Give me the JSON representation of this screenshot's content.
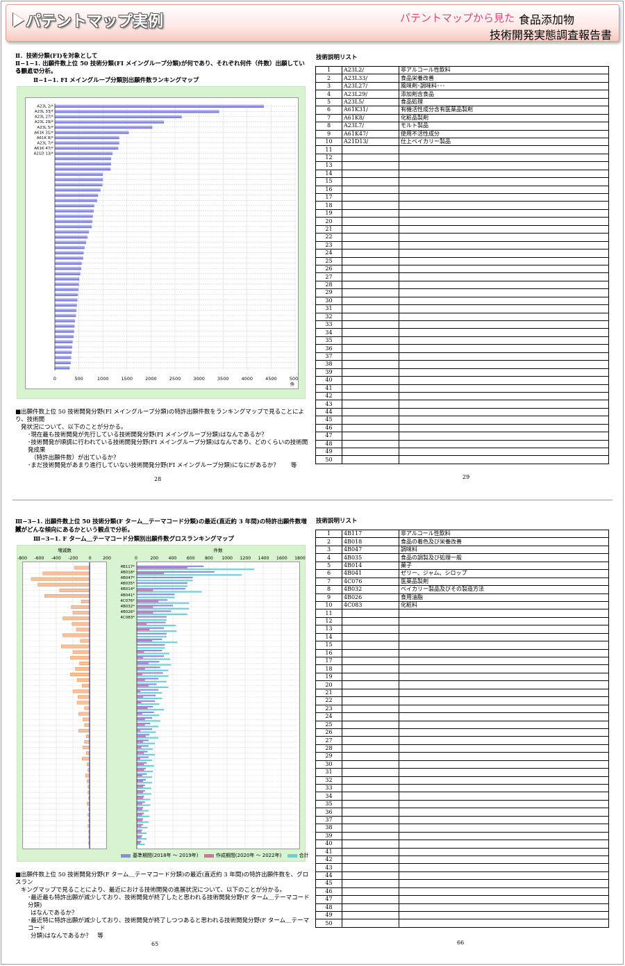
{
  "header": {
    "title": "パテントマップ実例",
    "subtitle_pink": "パテントマップから見た",
    "subtitle_black": "食品添加物",
    "subtitle_line2": "技術開発実態調査報告書"
  },
  "top_left": {
    "section": "Ⅱ．技術分類(FI)を対象として",
    "heading": "Ⅱ−1−1. 出願件数上位 50 技術分類(FI メイングループ分類)が何であり、それぞれ何件（件数）出願しているかとい",
    "heading2": "う観点で分析。",
    "chart_title": "Ⅱ−1−1. FI メイングループ分類別出願件数ランキングマップ",
    "unit": "件",
    "bullets": [
      "■出願件数上位 50 技術開発分野(FI メイングループ分類)の特許出願件数をランキングマップで見ることにより、技術開",
      "発状況について、以下のことが分かる。",
      "･現在最も技術開発が先行している技術開発分野(FI メイングループ分類)はなんであるか？",
      "･技術開発が順調に行われている技術開発分野(FI メイングループ分類)はなんであり、どのくらいの技術開発成果",
      "（特許出願件数）が出ているか？",
      "･まだ技術開発があまり進行していない技術開発分野(FI メイングループ分類)になにがあるか？　　等"
    ],
    "page": "28"
  },
  "top_right": {
    "title": "技術説明リスト",
    "rows": [
      [
        "1",
        "A23L2/",
        "非アルコール性飲料"
      ],
      [
        "2",
        "A23L33/",
        "食品栄養改善"
      ],
      [
        "3",
        "A23L27/",
        "風味剤･調味料･･･"
      ],
      [
        "4",
        "A23L29/",
        "添加剤含食品"
      ],
      [
        "5",
        "A23L5/",
        "食品処理"
      ],
      [
        "6",
        "A61K31/",
        "有機活性成分含有医薬品製剤"
      ],
      [
        "7",
        "A61K8/",
        "化粧品製剤"
      ],
      [
        "8",
        "A23L7/",
        "モルト製品"
      ],
      [
        "9",
        "A61K47/",
        "使用不活性成分"
      ],
      [
        "10",
        "A21D13/",
        "仕上ベイカリー製品"
      ]
    ],
    "page": "29"
  },
  "bottom_left": {
    "heading": "Ⅲ−3−1. 出願件数上位 50 技術分類(F ターム＿テーマコード分類)の最近(直近約 3 年間)の特許出願件数増減",
    "heading2": "数がどんな傾向にあるかという観点で分析。",
    "chart_title": "Ⅲ−3−1. F ターム＿テーマコード分類別出願件数グロスランキングマップ",
    "left_axis_title": "増減数",
    "right_axis_title": "件数",
    "legend": [
      "基準期間(2018年 ～ 2019年)",
      "作成期間(2020年 ～ 2022年)",
      "合計"
    ],
    "bullets": [
      "■出願件数上位 50 技術開発分野(F ターム＿テーマコード分類)の最近(直近約 3 年間)の特許出願件数を、グロスラン",
      "キングマップで見ることにより、最近における技術開発の進展状況について、以下のことが分かる。",
      "･最近最も特許出願が減少しており、技術開発が終了したと思われる技術開発分野(F ターム＿テーマコード分類)",
      "はなんであるか？",
      "･最近特に特許出願が減少しており、技術開発が終了しつつあると思われる技術開発分野(F ターム＿テーマコード",
      "分類)はなんであるか？　等"
    ],
    "page": "65"
  },
  "bottom_right": {
    "title": "技術説明リスト",
    "rows": [
      [
        "1",
        "4B117",
        "非アルコール性飲料"
      ],
      [
        "2",
        "4B018",
        "食品の着色及び栄養改善"
      ],
      [
        "3",
        "4B047",
        "調味料"
      ],
      [
        "4",
        "4B035",
        "食品の調製及び処理一般"
      ],
      [
        "5",
        "4B014",
        "菓子"
      ],
      [
        "6",
        "4B041",
        "ゼリー、ジャム、シロップ"
      ],
      [
        "7",
        "4C076",
        "医薬品製剤"
      ],
      [
        "8",
        "4B032",
        "ベイカリー製品及びその製造方法"
      ],
      [
        "9",
        "4B026",
        "食用油脂"
      ],
      [
        "10",
        "4C083",
        "化粧料"
      ]
    ],
    "page": "66"
  },
  "chart_data": [
    {
      "type": "bar",
      "orientation": "horizontal",
      "title": "Ⅱ−1−1. FI メイングループ分類別出願件数ランキングマップ",
      "xlabel": "件",
      "xlim": [
        0,
        5000
      ],
      "xticks": [
        0,
        500,
        1000,
        1500,
        2000,
        2500,
        3000,
        3500,
        4000,
        4500,
        5000
      ],
      "categories": [
        "A23L 2/*",
        "A23L 33/*",
        "A23L 27/*",
        "A23L 29/*",
        "A23L 5/*",
        "A61K 31/*",
        "A61K 8/*",
        "A23L 7/*",
        "A61K 47/*",
        "A21D 13/*"
      ],
      "values": [
        4350,
        3420,
        2640,
        2270,
        2030,
        1540,
        1340,
        1340,
        1320,
        1200,
        1170,
        1170,
        1160,
        1000,
        1000,
        990,
        950,
        900,
        880,
        820,
        810,
        790,
        780,
        770,
        710,
        680,
        650,
        620,
        600,
        590,
        560,
        550,
        530,
        510,
        500,
        490,
        480,
        470,
        460,
        450,
        440,
        420,
        410,
        400,
        390,
        370,
        360,
        350,
        340,
        330,
        310
      ]
    },
    {
      "type": "bar",
      "orientation": "horizontal",
      "title": "Ⅲ−3−1. F ターム＿テーマコード分類別出願件数グロスランキングマップ",
      "xlabel": "増減数",
      "xlim": [
        -800,
        200
      ],
      "xticks": [
        -800,
        -600,
        -400,
        -200,
        0,
        200
      ],
      "values": [
        -180,
        -560,
        -700,
        -620,
        -360,
        -540,
        -100,
        -220,
        -200,
        -320,
        -210,
        -160,
        -320,
        -110,
        -340,
        -200,
        -230,
        -120,
        -170,
        -230,
        -150,
        -90,
        -200,
        -140,
        -150,
        -60,
        -130,
        -80,
        -60,
        -130,
        -40,
        -60,
        -80,
        -40,
        -90,
        -30,
        -20,
        -50,
        -30,
        -20,
        -20,
        -10,
        -30,
        -10,
        -20,
        -10,
        -20,
        -10,
        -10,
        -10
      ]
    },
    {
      "type": "bar",
      "orientation": "horizontal",
      "title": "Ⅲ−3−1. F ターム＿テーマコード分類別出願件数グロスランキングマップ",
      "xlabel": "件数",
      "xlim": [
        0,
        1800
      ],
      "xticks": [
        0,
        200,
        400,
        600,
        800,
        1000,
        1200,
        1400,
        1600,
        1800
      ],
      "categories": [
        "4B117*",
        "4B018*",
        "4B047*",
        "4B035*",
        "4B014*",
        "4B041*",
        "4C076*",
        "4B032*",
        "4B026*",
        "4C083*"
      ],
      "series": [
        {
          "name": "基準期間(2018年 ～ 2019年)",
          "values": [
            740,
            860,
            620,
            560,
            540,
            420,
            340,
            400,
            380,
            330,
            320,
            300,
            330,
            280,
            310,
            280,
            300,
            250,
            260,
            290,
            240,
            220,
            240,
            210,
            200,
            180,
            190,
            170,
            150,
            170,
            140,
            130,
            130,
            120,
            130,
            110,
            100,
            110,
            100,
            90,
            90,
            80,
            90,
            70,
            80,
            70,
            70,
            60,
            60,
            50
          ]
        },
        {
          "name": "作成期間(2020年 ～ 2022年)",
          "values": [
            560,
            300,
            0,
            0,
            180,
            0,
            240,
            180,
            180,
            0,
            110,
            140,
            0,
            170,
            0,
            80,
            70,
            130,
            90,
            60,
            90,
            130,
            40,
            70,
            50,
            120,
            60,
            90,
            90,
            40,
            100,
            70,
            50,
            80,
            40,
            80,
            80,
            60,
            70,
            70,
            70,
            70,
            60,
            60,
            60,
            60,
            50,
            50,
            50,
            40
          ]
        },
        {
          "name": "合計",
          "values": [
            1300,
            1160,
            620,
            560,
            720,
            420,
            580,
            580,
            560,
            330,
            430,
            440,
            330,
            450,
            310,
            360,
            370,
            380,
            350,
            350,
            330,
            350,
            280,
            280,
            250,
            300,
            250,
            260,
            240,
            210,
            240,
            200,
            180,
            200,
            170,
            190,
            180,
            170,
            170,
            160,
            160,
            150,
            150,
            130,
            140,
            130,
            120,
            110,
            110,
            90
          ]
        }
      ],
      "colors": {
        "base": "#8b8be0",
        "recent": "#e06aa0",
        "total": "#63d2d8",
        "decrease": "#f0a06a"
      }
    }
  ]
}
